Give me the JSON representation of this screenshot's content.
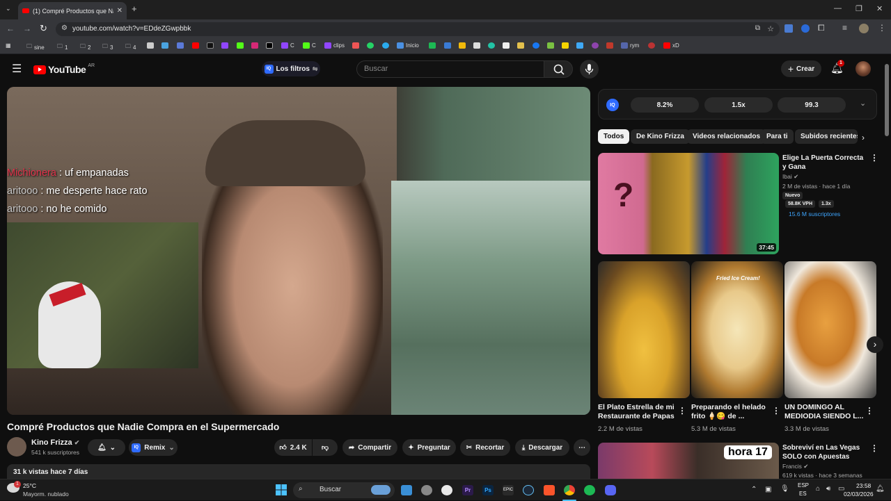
{
  "browser": {
    "tab_title": "(1) Compré Productos que Nadie Compra en el Supermercado",
    "url": "youtube.com/watch?v=EDdeZGwpbbk",
    "bookmarks": [
      "sine",
      "1",
      "2",
      "3",
      "4",
      "C",
      "C",
      "clips",
      "Inicio",
      "rym",
      "xD"
    ]
  },
  "yt_header": {
    "logo_text": "YouTube",
    "country": "AR",
    "filters_label": "Los filtros",
    "search_placeholder": "Buscar",
    "create_label": "Crear",
    "notif_count": "1",
    "iq_label": "IQ"
  },
  "video": {
    "chat": [
      {
        "user": "Michionera",
        "text": ": uf empanadas",
        "user_color": "#e0314a"
      },
      {
        "user": "aritooo",
        "text": ": me desperte hace rato",
        "user_color": "#c8c8c8"
      },
      {
        "user": "aritooo",
        "text": ": no he comido",
        "user_color": "#c8c8c8"
      }
    ],
    "title": "Compré Productos que Nadie Compra en el Supermercado",
    "channel": "Kino Frizza",
    "subscribers": "541 k suscriptores",
    "remix_label": "Remix",
    "likes": "2.4 K",
    "share_label": "Compartir",
    "ask_label": "Preguntar",
    "clip_label": "Recortar",
    "download_label": "Descargar",
    "views_date": "31 k vistas  hace 7 días"
  },
  "iq_metrics": [
    "8.2%",
    "1.5x",
    "99.3"
  ],
  "chips": [
    "Todos",
    "De Kino Frizza",
    "Videos relacionados",
    "Para ti",
    "Subidos recientes"
  ],
  "featured": {
    "title": "Elige La Puerta Correcta y Gana",
    "channel": "Ibai",
    "meta": "2 M de vistas · hace 1 día",
    "badge": "Nuevo",
    "vph": "58.8K VPH",
    "ratio": "1.3x",
    "subs": "15.6 M suscriptores",
    "duration": "37:45"
  },
  "shorts": [
    {
      "title": "El Plato Estrella de mi Restaurante de Papas",
      "views": "2.2 M de vistas"
    },
    {
      "title": "Preparando el helado frito 🍦😋 de ...",
      "views": "5.3 M de vistas",
      "thumb_text": "Fried Ice Cream!"
    },
    {
      "title": "UN DOMINGO AL MEDIODIA SIENDO L...",
      "views": "3.3 M de vistas"
    }
  ],
  "next_video": {
    "title": "Sobreviví en Las Vegas SOLO con Apuestas",
    "channel": "Francis",
    "meta": "619 k vistas · hace 3 semanas",
    "thumb_text": "hora 17"
  },
  "taskbar": {
    "weather_temp": "25°C",
    "weather_desc": "Mayorm. nublado",
    "weather_badge": "1",
    "search_label": "Buscar",
    "lang": "ESP",
    "lang_sub": "ES",
    "time": "23:58",
    "date": "02/03/2026"
  }
}
